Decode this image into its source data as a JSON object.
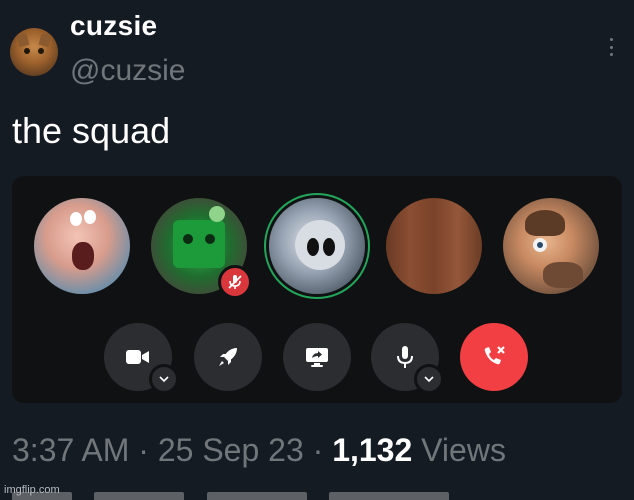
{
  "tweet": {
    "author": {
      "display_name": "cuzsie",
      "handle": "@cuzsie",
      "avatar_icon": "cat-avatar"
    },
    "more_icon": "more-vertical-icon",
    "text": "the squad",
    "timestamp": {
      "time": "3:37 AM",
      "date": "25 Sep 23",
      "separator": "·",
      "views_count": "1,132",
      "views_label": "Views"
    }
  },
  "call": {
    "participants": [
      {
        "avatar": "screaming-cartoon-avatar",
        "muted": false,
        "speaking": false
      },
      {
        "avatar": "green-screen-creature-avatar",
        "muted": true,
        "speaking": false
      },
      {
        "avatar": "pale-cartoon-figure-avatar",
        "muted": false,
        "speaking": true
      },
      {
        "avatar": "wood-texture-avatar",
        "muted": false,
        "speaking": false
      },
      {
        "avatar": "animated-man-avatar",
        "muted": false,
        "speaking": false
      }
    ],
    "controls": [
      {
        "name": "camera-button",
        "icon": "video-camera-icon",
        "has_options": true
      },
      {
        "name": "activities-button",
        "icon": "rocket-icon",
        "has_options": false
      },
      {
        "name": "screen-share-button",
        "icon": "screen-share-icon",
        "has_options": false
      },
      {
        "name": "microphone-button",
        "icon": "microphone-icon",
        "has_options": true
      },
      {
        "name": "disconnect-button",
        "icon": "hang-up-icon",
        "has_options": false
      }
    ],
    "colors": {
      "panel_bg": "#101113",
      "button_bg": "#2b2d31",
      "danger": "#f23f43",
      "speaking_ring": "#23a55a"
    }
  },
  "watermark": "imgflip.com",
  "colors": {
    "background": "#151b23",
    "primary_text": "#ffffff",
    "secondary_text": "#71767b"
  }
}
